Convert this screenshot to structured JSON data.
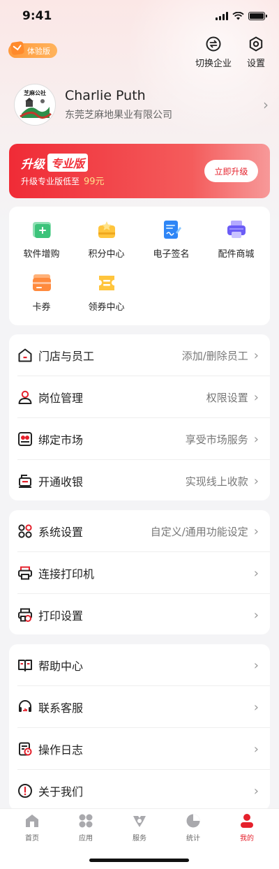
{
  "status_bar": {
    "time": "9:41"
  },
  "trial_badge": {
    "label": "体验版"
  },
  "top_actions": {
    "switch_company": "切换企业",
    "settings": "设置"
  },
  "profile": {
    "name": "Charlie Puth",
    "company": "东莞芝麻地果业有限公司",
    "logo_text": "芝麻公社"
  },
  "upgrade": {
    "prefix": "升级",
    "tag": "专业版",
    "subtitle": "升级专业版低至",
    "price": "99元",
    "button": "立即升级"
  },
  "grid": [
    {
      "label": "软件增购",
      "icon": "software-purchase-icon",
      "color": "#3cc37a"
    },
    {
      "label": "积分中心",
      "icon": "points-center-icon",
      "color": "#ffc53d"
    },
    {
      "label": "电子签名",
      "icon": "e-signature-icon",
      "color": "#2f86f6"
    },
    {
      "label": "配件商城",
      "icon": "accessory-mall-icon",
      "color": "#6b5cf6"
    },
    {
      "label": "卡券",
      "icon": "coupon-card-icon",
      "color": "#ff8a3d"
    },
    {
      "label": "领券中心",
      "icon": "coupon-center-icon",
      "color": "#ffc53d"
    }
  ],
  "menu_group_1": [
    {
      "label": "门店与员工",
      "hint": "添加/删除员工",
      "icon": "store-icon"
    },
    {
      "label": "岗位管理",
      "hint": "权限设置",
      "icon": "person-icon"
    },
    {
      "label": "绑定市场",
      "hint": "享受市场服务",
      "icon": "market-icon"
    },
    {
      "label": "开通收银",
      "hint": "实现线上收款",
      "icon": "cashier-icon"
    }
  ],
  "menu_group_2": [
    {
      "label": "系统设置",
      "hint": "自定义/通用功能设定",
      "icon": "system-settings-icon"
    },
    {
      "label": "连接打印机",
      "hint": "",
      "icon": "printer-icon"
    },
    {
      "label": "打印设置",
      "hint": "",
      "icon": "print-settings-icon"
    }
  ],
  "menu_group_3": [
    {
      "label": "帮助中心",
      "hint": "",
      "icon": "help-book-icon"
    },
    {
      "label": "联系客服",
      "hint": "",
      "icon": "headset-icon"
    },
    {
      "label": "操作日志",
      "hint": "",
      "icon": "log-icon"
    },
    {
      "label": "关于我们",
      "hint": "",
      "icon": "info-icon"
    }
  ],
  "tab_bar": [
    {
      "label": "首页",
      "icon": "home-tab-icon",
      "active": false
    },
    {
      "label": "应用",
      "icon": "apps-tab-icon",
      "active": false
    },
    {
      "label": "服务",
      "icon": "service-tab-icon",
      "active": false
    },
    {
      "label": "统计",
      "icon": "stats-tab-icon",
      "active": false
    },
    {
      "label": "我的",
      "icon": "profile-tab-icon",
      "active": true
    }
  ],
  "colors": {
    "accent": "#e5212c",
    "badge": "#ff9a3c"
  }
}
